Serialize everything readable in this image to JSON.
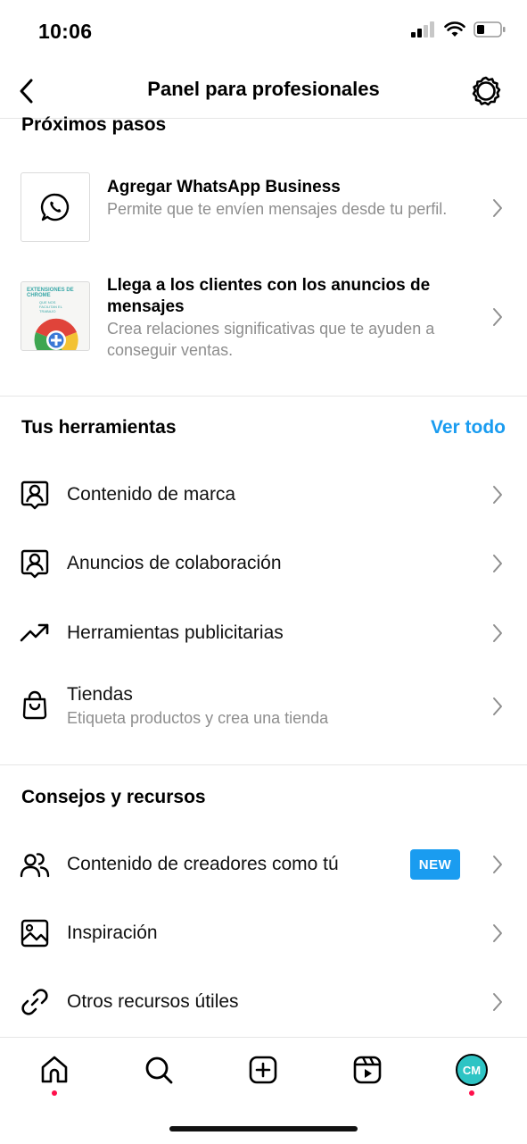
{
  "status_bar": {
    "time": "10:06"
  },
  "header": {
    "title": "Panel para profesionales"
  },
  "next_steps": {
    "title": "Próximos pasos",
    "items": [
      {
        "title": "Agregar WhatsApp Business",
        "description": "Permite que te envíen mensajes desde tu perfil.",
        "icon": "whatsapp-icon"
      },
      {
        "title": "Llega a los clientes con los anuncios de mensajes",
        "description": "Crea relaciones significativas que te ayuden a conseguir ventas.",
        "thumb_text_1": "EXTENSIONES DE CHROME",
        "thumb_text_2": "QUE NOS FACILITAN EL TRABAJO",
        "icon": "chrome-extensions-thumbnail"
      }
    ]
  },
  "tools": {
    "title": "Tus herramientas",
    "see_all": "Ver todo",
    "items": [
      {
        "label": "Contenido de marca",
        "icon": "branded-content-icon"
      },
      {
        "label": "Anuncios de colaboración",
        "icon": "partnership-ads-icon"
      },
      {
        "label": "Herramientas publicitarias",
        "icon": "trending-up-icon"
      },
      {
        "label": "Tiendas",
        "sublabel": "Etiqueta productos y crea una tienda",
        "icon": "shopping-bag-icon"
      }
    ]
  },
  "tips": {
    "title": "Consejos y recursos",
    "items": [
      {
        "label": "Contenido de creadores como tú",
        "badge": "NEW",
        "icon": "people-icon"
      },
      {
        "label": "Inspiración",
        "icon": "image-icon"
      },
      {
        "label": "Otros recursos útiles",
        "icon": "link-icon"
      }
    ]
  },
  "tab_bar": {
    "items": [
      "home-icon",
      "search-icon",
      "create-icon",
      "reels-icon",
      "profile-avatar"
    ],
    "avatar_text": "CM"
  },
  "colors": {
    "accent": "#1a9cf0",
    "notification_dot": "#ff0f4b",
    "secondary_text": "#8e8e8e"
  }
}
